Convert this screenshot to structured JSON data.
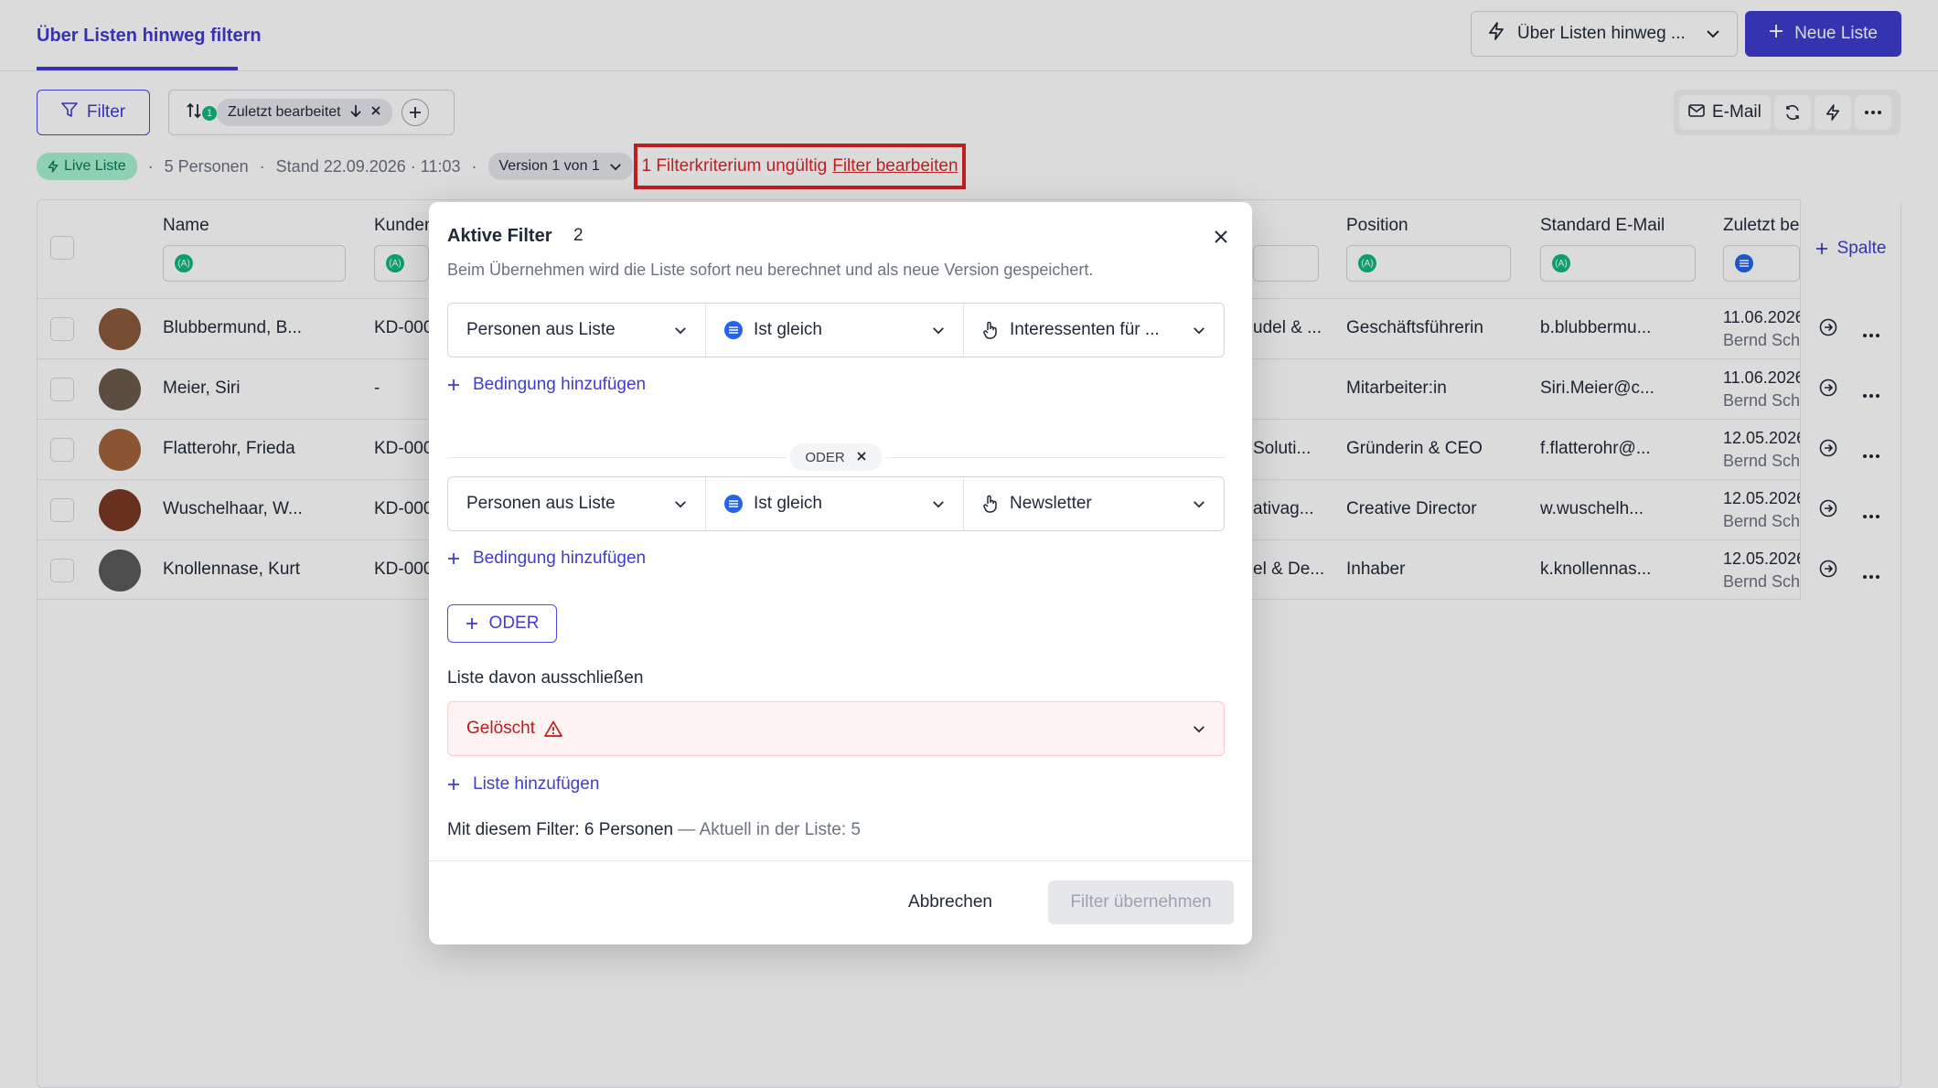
{
  "header": {
    "title_tab": "Über Listen hinweg filtern",
    "list_select": "Über Listen hinweg ...",
    "new_list_label": "Neue Liste"
  },
  "toolbar": {
    "filter_label": "Filter",
    "sort_count": "1",
    "sort_chip": "Zuletzt bearbeitet",
    "email_label": "E-Mail"
  },
  "meta": {
    "live_label": "Live Liste",
    "persons": "5 Personen",
    "stand": "Stand 22.09.2026 · 11:03",
    "version": "Version 1 von 1",
    "warning_text": "1 Filterkriterium ungültig",
    "warning_link": "Filter bearbeiten"
  },
  "table": {
    "columns": {
      "name": "Name",
      "kunden": "Kunden",
      "position": "Position",
      "email": "Standard E-Mail",
      "edited": "Zuletzt be"
    },
    "add_column": "Spalte",
    "rows": [
      {
        "name": "Blubbermund, B...",
        "kunde": "KD-000",
        "company": "udel & ...",
        "position": "Geschäftsführerin",
        "email": "b.blubbermu...",
        "date": "11.06.2026",
        "editor": "Bernd Sch",
        "avatar_color": "#8b5a3c"
      },
      {
        "name": "Meier, Siri",
        "kunde": "-",
        "company": "",
        "position": "Mitarbeiter:in",
        "email": "Siri.Meier@c...",
        "date": "11.06.2026",
        "editor": "Bernd Sch",
        "avatar_color": "#6b5a4a"
      },
      {
        "name": "Flatterohr, Frieda",
        "kunde": "KD-000",
        "company": "Soluti...",
        "position": "Gründerin & CEO",
        "email": "f.flatterohr@...",
        "date": "12.05.2026",
        "editor": "Bernd Sch",
        "avatar_color": "#a0643c"
      },
      {
        "name": "Wuschelhaar, W...",
        "kunde": "KD-000",
        "company": "ativag...",
        "position": "Creative Director",
        "email": "w.wuschelh...",
        "date": "12.05.2026",
        "editor": "Bernd Sch",
        "avatar_color": "#7a3a22"
      },
      {
        "name": "Knollennase, Kurt",
        "kunde": "KD-000",
        "company": "el & De...",
        "position": "Inhaber",
        "email": "k.knollennas...",
        "date": "12.05.2026",
        "editor": "Bernd Sch",
        "avatar_color": "#5a5a5a"
      }
    ]
  },
  "modal": {
    "title": "Aktive Filter",
    "count": "2",
    "subtitle": "Beim Übernehmen wird die Liste sofort neu berechnet und als neue Version gespeichert.",
    "group1": {
      "field": "Personen aus Liste",
      "operator": "Ist gleich",
      "value": "Interessenten für ..."
    },
    "group2": {
      "field": "Personen aus Liste",
      "operator": "Ist gleich",
      "value": "Newsletter"
    },
    "add_condition": "Bedingung hinzufügen",
    "oder_label": "ODER",
    "oder_button": "ODER",
    "exclude_label": "Liste davon ausschließen",
    "deleted_label": "Gelöscht",
    "add_list": "Liste hinzufügen",
    "result_main": "Mit diesem Filter: 6 Personen",
    "result_muted": "— Aktuell in der Liste: 5",
    "cancel": "Abbrechen",
    "apply": "Filter übernehmen"
  }
}
